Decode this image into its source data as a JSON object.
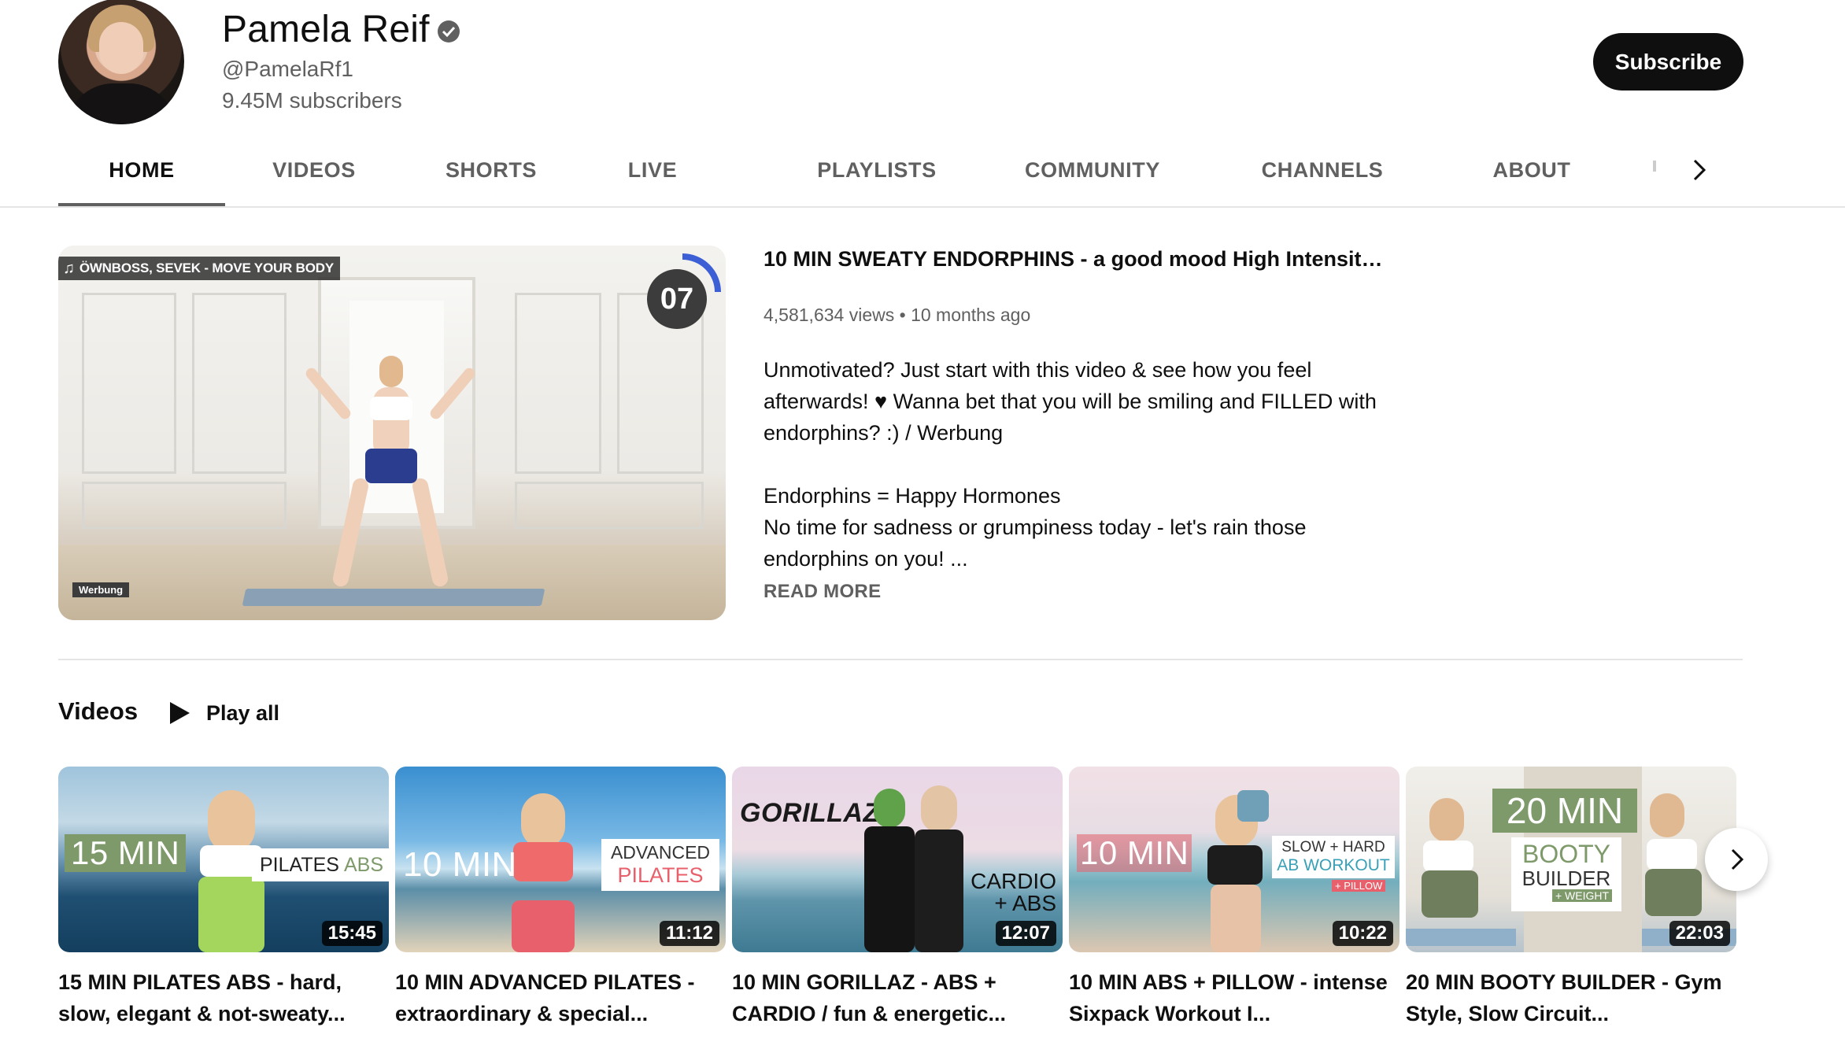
{
  "channel": {
    "name": "Pamela Reif",
    "handle": "@PamelaRf1",
    "subscribers": "9.45M subscribers",
    "subscribe_label": "Subscribe"
  },
  "tabs": [
    {
      "label": "HOME",
      "active": true
    },
    {
      "label": "VIDEOS"
    },
    {
      "label": "SHORTS"
    },
    {
      "label": "LIVE"
    },
    {
      "label": "PLAYLISTS"
    },
    {
      "label": "COMMUNITY"
    },
    {
      "label": "CHANNELS"
    },
    {
      "label": "ABOUT"
    }
  ],
  "featured": {
    "music_badge": "ÖWNBOSS, SEVEK - MOVE YOUR BODY",
    "timer": "07",
    "werbung": "Werbung",
    "title": "10 MIN SWEATY ENDORPHINS - a good mood High Intensity ...",
    "views": "4,581,634 views",
    "age": "10 months ago",
    "description_1": "Unmotivated? Just start with this video & see how you feel afterwards! ♥ Wanna bet that you will be smiling and FILLED with endorphins? :) / Werbung",
    "description_2": "Endorphins = Happy Hormones",
    "description_3": "No time for sadness or grumpiness today - let's rain those endorphins on you! ...",
    "read_more": "READ MORE"
  },
  "shelf": {
    "title": "Videos",
    "play_all": "Play all",
    "videos": [
      {
        "thumb_text_1": "15 MIN",
        "thumb_text_2": "PILATES",
        "thumb_text_3": "ABS",
        "duration": "15:45",
        "title": "15 MIN PILATES ABS - hard, slow, elegant & not-sweaty..."
      },
      {
        "thumb_text_1": "10 MIN",
        "thumb_text_2": "ADVANCED",
        "thumb_text_3": "PILATES",
        "duration": "11:12",
        "title": "10 MIN ADVANCED PILATES - extraordinary & special..."
      },
      {
        "thumb_text_1": "GORILLAZ",
        "thumb_text_2": "CARDIO",
        "thumb_text_3": "+ ABS",
        "duration": "12:07",
        "title": "10 MIN GORILLAZ - ABS + CARDIO / fun & energetic..."
      },
      {
        "thumb_text_1": "10 MIN",
        "thumb_text_2": "SLOW + HARD",
        "thumb_text_3": "AB WORKOUT",
        "thumb_text_4": "+ PILLOW",
        "duration": "10:22",
        "title": "10 MIN ABS + PILLOW - intense Sixpack Workout I..."
      },
      {
        "thumb_text_1": "20 MIN",
        "thumb_text_2": "BOOTY",
        "thumb_text_3": "BUILDER",
        "thumb_text_4": "+ WEIGHT",
        "duration": "22:03",
        "title": "20 MIN BOOTY BUILDER - Gym Style, Slow Circuit..."
      }
    ]
  },
  "icons": {
    "verified": "verified-check-icon",
    "tabs_next": "chevron-right-icon",
    "play_all": "play-icon",
    "music": "music-note-icon",
    "shelf_next": "chevron-right-icon"
  },
  "colors": {
    "subscribe_bg": "#0f0f0f",
    "secondary_text": "#606060",
    "thumb_green_label": "#7e9a6a",
    "thumb_coral_label": "#e8606b"
  }
}
